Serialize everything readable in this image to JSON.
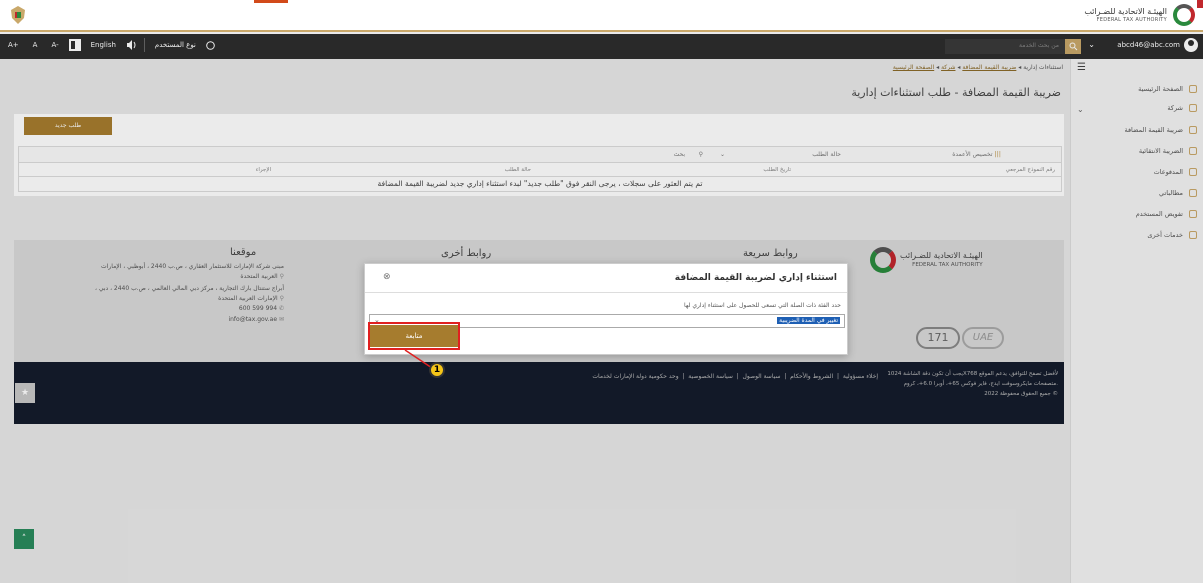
{
  "header": {
    "fta_name_ar": "الهيئـة الاتحادية للضـرائب",
    "fta_name_en": "FEDERAL TAX AUTHORITY"
  },
  "toolbar": {
    "font_inc": "A+",
    "font_reset": "A",
    "font_dec": "A-",
    "language": "English",
    "speaker_icon": "speaker-icon",
    "user_type": "نوع المستخدم",
    "search_placeholder": "من بحث الخدمة",
    "user_email": "abcd46@abc.com"
  },
  "sidebar": {
    "items": [
      {
        "label": "الصفحة الرئيسية"
      },
      {
        "label": "شركة"
      },
      {
        "label": "ضريبة القيمة المضافة"
      },
      {
        "label": "الضريبة الانتقائية"
      },
      {
        "label": "المدفوعات"
      },
      {
        "label": "مطالباتي"
      },
      {
        "label": "تفويض المستخدم"
      },
      {
        "label": "خدمات أخرى"
      }
    ]
  },
  "breadcrumb": {
    "home": "الصفحة الرئيسية",
    "company": "شركة",
    "vat": "ضريبة القيمة المضافة",
    "current": "استثناءات إدارية"
  },
  "page": {
    "title": "ضريبة القيمة المضافة - طلب استثناءات إدارية",
    "new_request": "طلب جديد"
  },
  "table": {
    "customize_columns": "تخصيص الأعمدة",
    "status_filter": "حالة الطلب",
    "search": "بحث",
    "columns": [
      "رقم النموذج المرجعي",
      "تاريخ الطلب",
      "حالة الطلب",
      "الإجراء"
    ],
    "empty_message": "تم يتم العثور على سجلات ، يرجى النقر فوق \"طلب جديد\" لبدء استثناء إداري جديد لضريبة القيمة المضافة"
  },
  "footer": {
    "quick_links": "روابط سريعة",
    "other_links": "روابط أخرى",
    "our_location": "موقعنا",
    "address1": "مبنى شركة الإمارات للاستثمار العقاري ، ص.ب 2440 ، أبوظبي ، الإمارات العربية المتحدة",
    "address2": "أبراج ستنتال بارك التجارية ، مركز دبي المالي العالمي ، ص.ب 2440 ، دبي ، الإمارات العربية المتحدة",
    "phone": "600 599 994",
    "email": "info@tax.gov.ae",
    "links": [
      "إخلاء مسؤولية",
      "الشروط والأحكام",
      "سياسة الوصول",
      "سياسة الخصوصية",
      "وحد حكومية دولة الإمارات لخدمات"
    ],
    "note": "يجب أن تكون دقة الشاشة 1024X768 لأفضل تصفح للتوافق، يدعم الموقع متصفحات مايكروسوفت ايدج، فاير فوكس 65+، أوبرا 6.0+، كروم.",
    "copyright": "جميع الحقوق محفوظة 2022 ©",
    "badge171": "171",
    "uae_logo": "UAE"
  },
  "modal": {
    "title": "استثناء إداري لضريبة القيمة المضافة",
    "hint": "حدد الفئة ذات الصلة التي تسعى للحصول على استثناء إداري لها",
    "selected_option": "تغيير في المدة الضريبية",
    "submit": "متابعة"
  },
  "callout": {
    "number": "1"
  },
  "colors": {
    "gold": "#a67c2e",
    "dark_toolbar": "#2d2d2d",
    "footer_dark": "#141c2c",
    "highlight_red": "#e02020",
    "callout_yellow": "#f5c518"
  }
}
